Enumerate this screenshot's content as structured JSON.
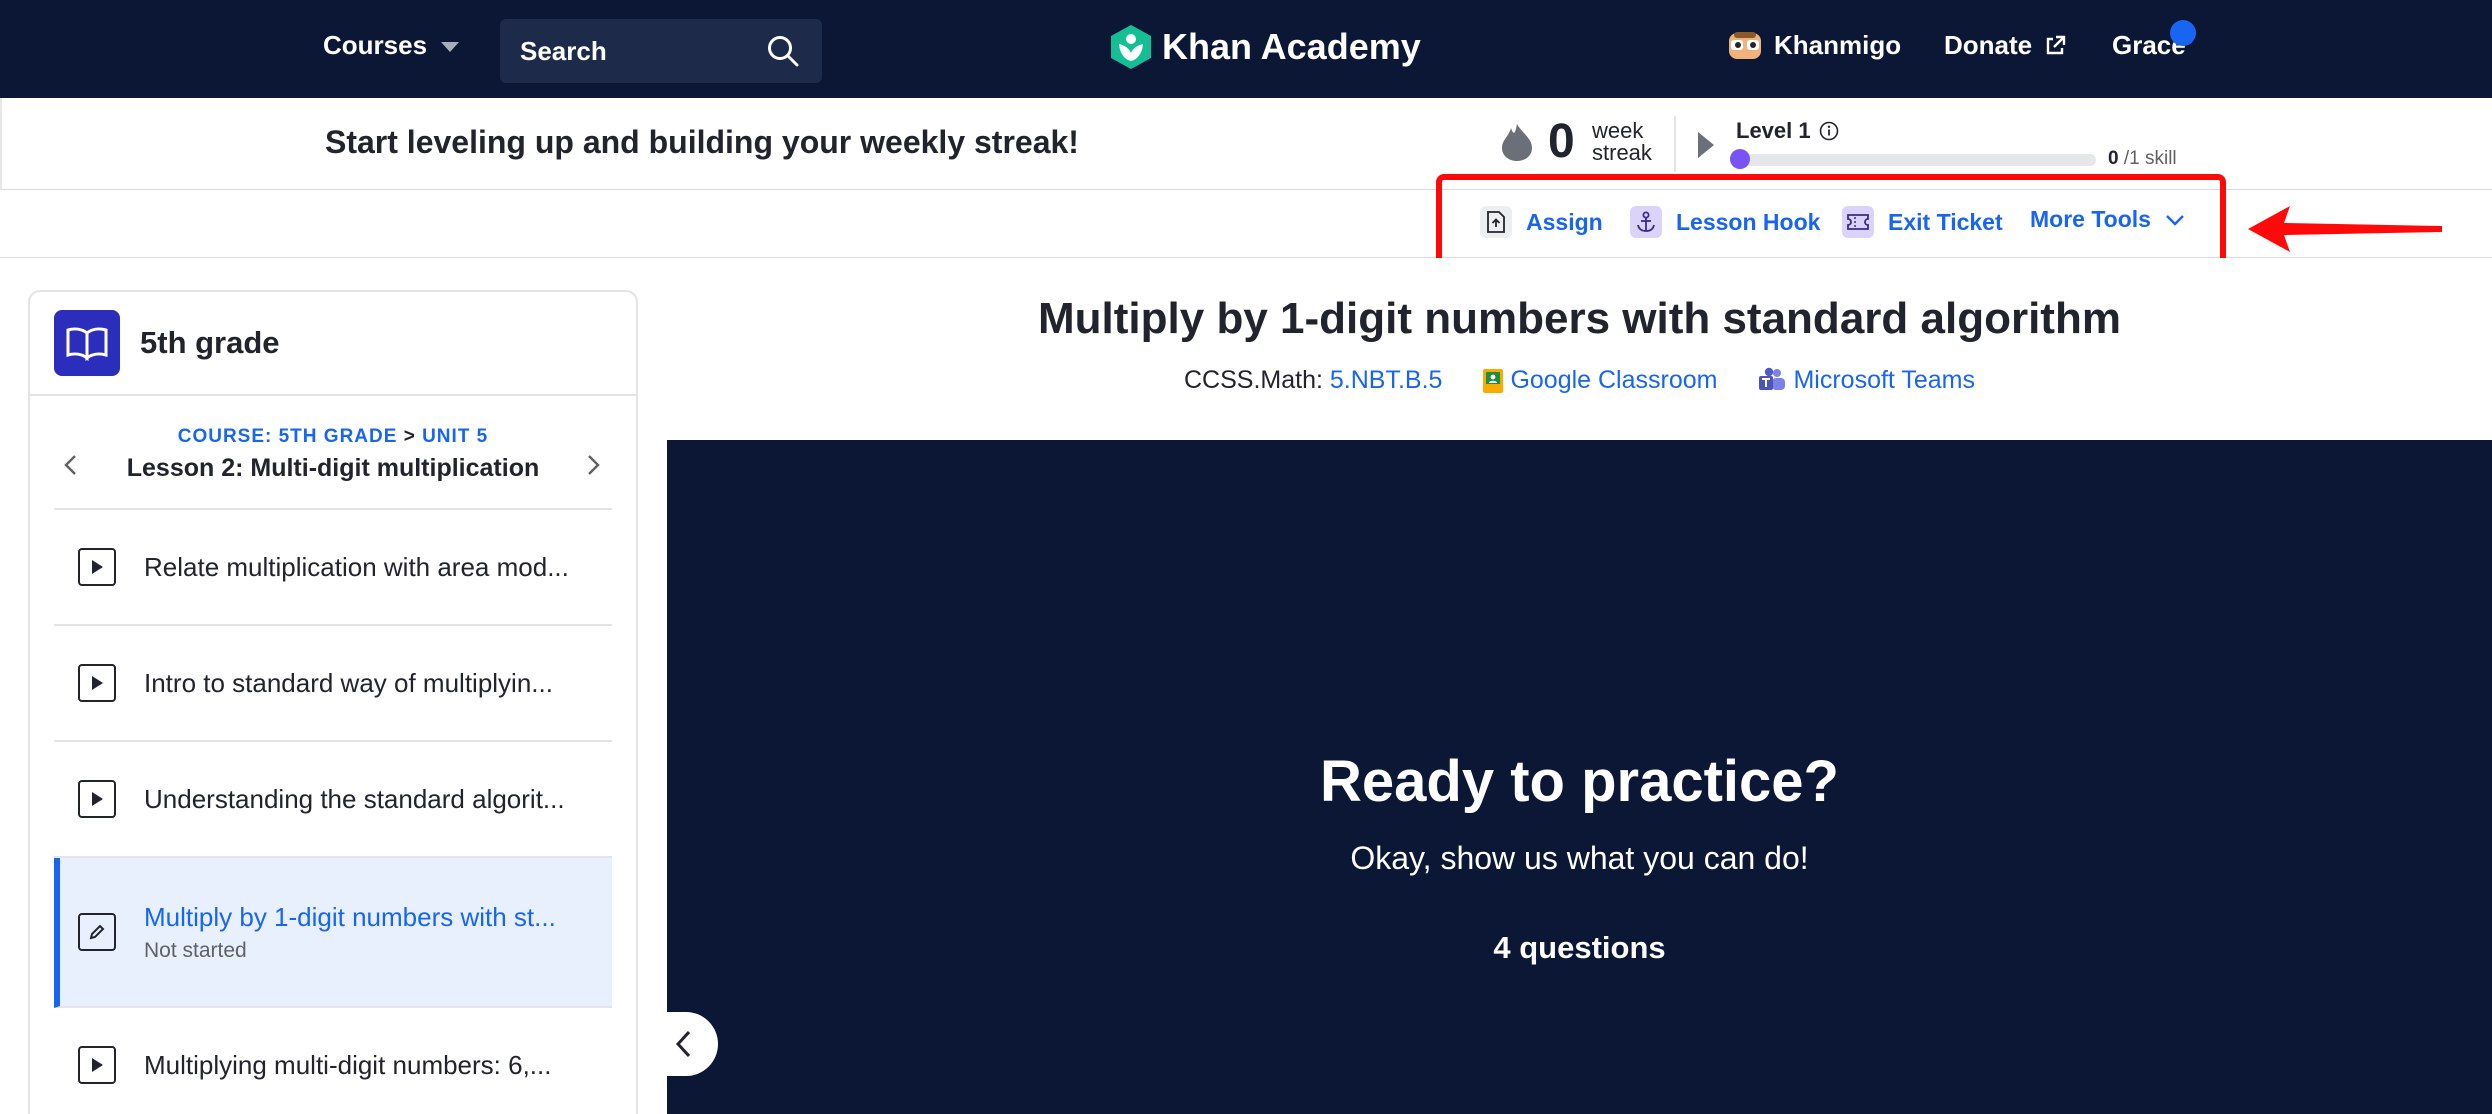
{
  "nav": {
    "courses_label": "Courses",
    "search_placeholder": "Search",
    "logo_text": "Khan Academy",
    "khanmigo_label": "Khanmigo",
    "donate_label": "Donate",
    "user_name": "Grace"
  },
  "streak": {
    "message": "Start leveling up and building your weekly streak!",
    "count": "0",
    "label_line1": "week",
    "label_line2": "streak",
    "level_label": "Level 1",
    "progress_fraction": 0,
    "skill_done": "0",
    "skill_total": "/1 skill"
  },
  "tools": {
    "assign": "Assign",
    "lesson_hook": "Lesson Hook",
    "exit_ticket": "Exit Ticket",
    "more_tools": "More Tools"
  },
  "sidebar": {
    "grade_title": "5th grade",
    "crumb_course": "COURSE: 5TH GRADE",
    "crumb_sep": ">",
    "crumb_unit": "UNIT 5",
    "lesson_title": "Lesson 2: Multi-digit multiplication",
    "items": [
      {
        "label": "Relate multiplication with area mod...",
        "type": "video"
      },
      {
        "label": "Intro to standard way of multiplyin...",
        "type": "video"
      },
      {
        "label": "Understanding the standard algorit...",
        "type": "video"
      },
      {
        "label": "Multiply by 1-digit numbers with st...",
        "type": "exercise",
        "status": "Not started",
        "active": true
      },
      {
        "label": "Multiplying multi-digit numbers: 6,...",
        "type": "video"
      }
    ]
  },
  "main": {
    "title": "Multiply by 1-digit numbers with standard algorithm",
    "standard_prefix": "CCSS.Math:",
    "standard_code": "5.NBT.B.5",
    "google_classroom": "Google Classroom",
    "microsoft_teams": "Microsoft Teams",
    "ready_title": "Ready to practice?",
    "ready_sub": "Okay, show us what you can do!",
    "question_count": "4 questions"
  },
  "colors": {
    "nav_bg": "#0b1734",
    "accent": "#1865f2",
    "highlight": "#ff0a0a",
    "level_purple": "#7854f7"
  },
  "icons": [
    "chevron-down-icon",
    "search-icon",
    "khan-logo-icon",
    "khanmigo-icon",
    "external-link-icon",
    "flame-icon",
    "info-icon",
    "assign-icon",
    "anchor-icon",
    "ticket-icon",
    "book-icon",
    "play-icon",
    "pencil-icon",
    "google-classroom-icon",
    "teams-icon"
  ]
}
